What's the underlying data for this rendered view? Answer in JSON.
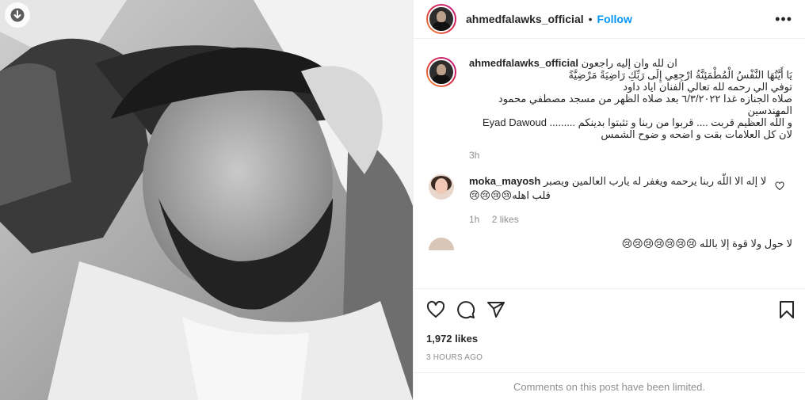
{
  "post": {
    "username": "ahmedfalawks_official",
    "separator": "•",
    "follow_label": "Follow",
    "more_icon": "more-horizontal-icon"
  },
  "caption": {
    "username": "ahmedfalawks_official",
    "lines": [
      "ان لله وان إليه راجعون",
      "يَا أَيَّتُهَا النَّفْسُ الْمُطْمَئِنَّةُ ارْجِعِي إِلَى رَبِّكِ رَاضِيَةً مَرْضِيَّةً",
      "توفي الي رحمه لله تعالي الفنان اياد داود",
      "صلاه الجنازه غدا ٦/٣/٢٠٢٢ بعد صلاه الظهر من مسجد مصطفي محمود المهندسين",
      "و اللّه العظيم قربت .... قربوا من ربنا و تثبتوا بدينكم ......... Eyad Dawoud",
      "لان كل العلامات بقت و اضحه و ضوح الشمس"
    ],
    "time": "3h"
  },
  "comments": [
    {
      "username": "moka_mayosh",
      "text": "لا إله الا اللّه ربنا يرحمه ويغفر له يارب العالمين ويصبر قلب اهله😢😢😢😢",
      "time": "1h",
      "likes": "2 likes"
    },
    {
      "username": "",
      "text": "لا حول ولا قوة إلا بالله 😢😢😢😢😢😢😢"
    }
  ],
  "actions": {
    "like_icon": "heart-icon",
    "comment_icon": "comment-icon",
    "share_icon": "share-icon",
    "save_icon": "bookmark-icon"
  },
  "likes_count": "1,972 likes",
  "posted_ago": "3 HOURS AGO",
  "comments_limited": "Comments on this post have been limited.",
  "colors": {
    "follow": "#0095f6",
    "muted": "#8e8e8e",
    "text": "#262626"
  }
}
